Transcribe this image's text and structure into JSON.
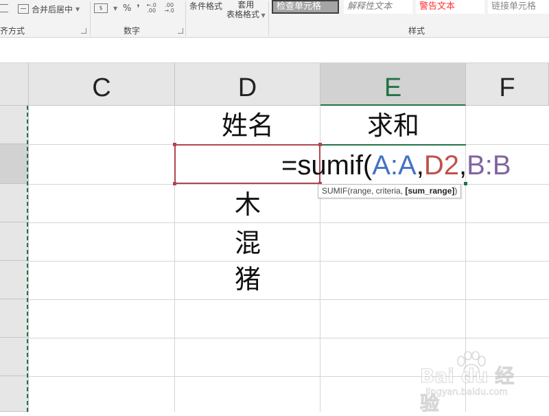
{
  "ribbon": {
    "alignment": {
      "group_label": "齐方式",
      "merge_label": "合并后居中"
    },
    "number": {
      "group_label": "数字",
      "percent_symbol": "%",
      "comma_symbol": "❜",
      "inc_decimal": "←.0\n.00",
      "dec_decimal": ".00\n→.0"
    },
    "styles": {
      "group_label": "样式",
      "conditional_label": "条件格式",
      "table_label_line1": "套用",
      "table_label_line2": "表格格式",
      "check_cell": "检查单元格",
      "explanatory": "解释性文本",
      "warning": "警告文本",
      "linked_cell": "链接单元格"
    }
  },
  "columns": [
    {
      "label": "C",
      "active": false
    },
    {
      "label": "D",
      "active": false
    },
    {
      "label": "E",
      "active": true
    },
    {
      "label": "F",
      "active": false
    }
  ],
  "cells": {
    "d_header": "姓名",
    "e_header": "求和",
    "d_values": [
      "木",
      "混",
      "猪"
    ]
  },
  "formula": {
    "prefix": "=sumif(",
    "ref1": "A:A",
    "comma1": ",",
    "ref2": "D2",
    "comma2": ",",
    "ref3": "B:B"
  },
  "tooltip": {
    "func": "SUMIF(range, criteria, ",
    "bold_arg": "[sum_range]",
    "close": ")"
  },
  "watermark": {
    "brand": "Bai du 经验",
    "url": "jingyan.baidu.com"
  },
  "colors": {
    "accent": "#217346",
    "ref_a": "#4472c4",
    "ref_d": "#c0504d",
    "ref_b": "#8064a2",
    "edit_border": "#b0464e"
  }
}
